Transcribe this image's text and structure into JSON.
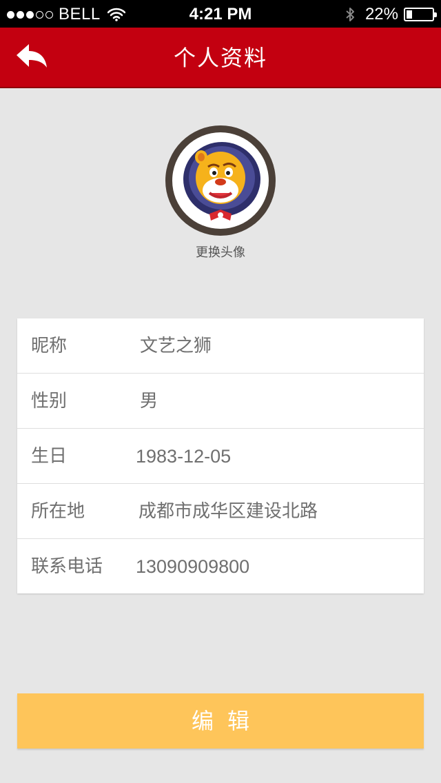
{
  "status_bar": {
    "carrier": "BELL",
    "signal_bars": 3,
    "signal_total": 5,
    "time": "4:21 PM",
    "battery_pct": "22%",
    "battery_level": 0.22,
    "icons": [
      "wifi-icon",
      "bluetooth-icon",
      "battery-icon"
    ]
  },
  "nav": {
    "title": "个人资料",
    "back_icon": "back-arrow-icon"
  },
  "profile": {
    "avatar_icon": "lion-mascot-avatar",
    "change_avatar_label": "更换头像"
  },
  "info_rows": [
    {
      "label": "昵称",
      "value": "文艺之狮"
    },
    {
      "label": "性别",
      "value": "男"
    },
    {
      "label": "生日",
      "value": "1983-12-05"
    },
    {
      "label": "所在地",
      "value": "成都市成华区建设北路"
    },
    {
      "label": "联系电话",
      "value": "13090909800"
    }
  ],
  "edit_button": {
    "label": "编辑"
  },
  "colors": {
    "nav_bg": "#c30010",
    "page_bg": "#e6e6e6",
    "button_bg": "#fec55a",
    "avatar_ring": "#4b4038"
  }
}
